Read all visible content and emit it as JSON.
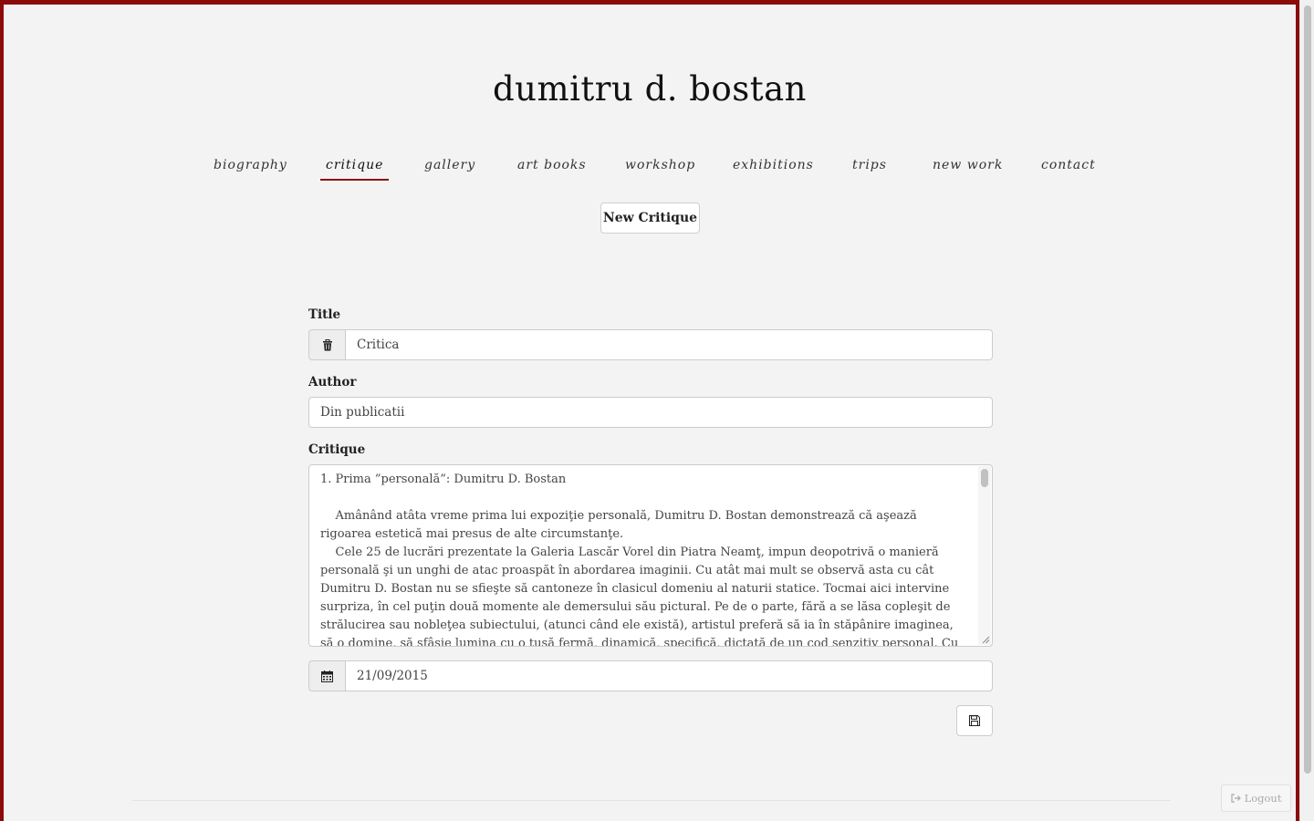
{
  "site": {
    "title": "dumitru d. bostan"
  },
  "nav": {
    "items": [
      {
        "label": "biography",
        "active": false
      },
      {
        "label": "critique",
        "active": true
      },
      {
        "label": "gallery",
        "active": false
      },
      {
        "label": "art books",
        "active": false
      },
      {
        "label": "workshop",
        "active": false
      },
      {
        "label": "exhibitions",
        "active": false
      },
      {
        "label": "trips",
        "active": false
      },
      {
        "label": "new work",
        "active": false
      },
      {
        "label": "contact",
        "active": false
      }
    ]
  },
  "actions": {
    "new_critique": "New Critique",
    "logout": "Logout"
  },
  "form": {
    "title_label": "Title",
    "title_value": "Critica",
    "author_label": "Author",
    "author_value": "Din publicatii",
    "critique_label": "Critique",
    "critique_lines": [
      "1. Prima ”personală”: Dumitru D. Bostan",
      "",
      "    Amânând atâta vreme prima lui expoziţie personală, Dumitru D. Bostan demonstrează că aşează rigoarea estetică mai presus de alte circumstanţe.",
      "    Cele 25 de lucrări prezentate la Galeria Lascăr Vorel din Piatra Neamţ, impun deopotrivă o manieră personală şi un unghi de atac proaspăt în abordarea imaginii. Cu atât mai mult se observă asta cu cât Dumitru D. Bostan nu se sfieşte să cantoneze în clasicul domeniu al naturii statice. Tocmai aici intervine surpriza, în cel puţin două momente ale demersului său pictural. Pe de o parte, fără a se lăsa copleşit de strălucirea sau nobleţea subiectului, (atunci când ele există), artistul preferă să ia în stăpânire imaginea, să o domine, să sfâşie lumina cu o tuşă fermă, dinamică, specifică, dictată de un cod senzitiv personal. Cu alte cuvinte, Dumitru D. Bostan nu se mulţumeşte să înregistreze"
    ],
    "date_value": "21/09/2015"
  },
  "colors": {
    "accent": "#8b0a0a",
    "background": "#f3f3f3"
  },
  "icons": {
    "title_addon": "trash-icon",
    "date_addon": "calendar-icon",
    "save": "floppy-disk-icon",
    "logout": "sign-out-icon"
  }
}
